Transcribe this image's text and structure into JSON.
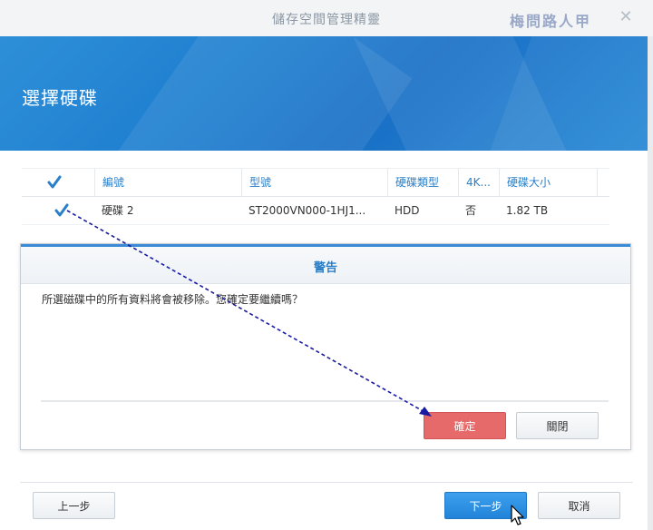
{
  "window": {
    "title": "儲存空間管理精靈",
    "watermark": "梅問路人甲",
    "close_glyph": "✕"
  },
  "banner": {
    "title": "選擇硬碟"
  },
  "table": {
    "columns": [
      "編號",
      "型號",
      "硬碟類型",
      "4K...",
      "硬碟大小"
    ],
    "rows": [
      {
        "checked": true,
        "id": "硬碟 2",
        "model": "ST2000VN000-1HJ1...",
        "type": "HDD",
        "fourk": "否",
        "size": "1.82 TB"
      }
    ],
    "header_checked": true
  },
  "warning": {
    "title": "警告",
    "message": "所選磁碟中的所有資料將會被移除。您確定要繼續嗎？",
    "confirm_label": "確定",
    "close_label": "關閉"
  },
  "footer": {
    "prev_label": "上一步",
    "next_label": "下一步",
    "cancel_label": "取消"
  },
  "colors": {
    "accent": "#2a7fc7",
    "banner": "#1f7fd0",
    "danger": "#e76a6a",
    "primary": "#2283d8"
  }
}
